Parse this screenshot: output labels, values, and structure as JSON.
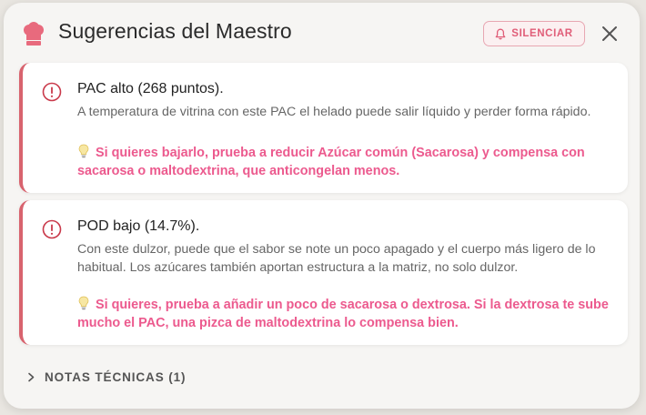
{
  "header": {
    "title": "Sugerencias del Maestro",
    "icon": "chef-hat-icon",
    "silence_label": "SILENCIAR",
    "close_icon": "close-icon"
  },
  "cards": [
    {
      "title": "PAC alto (268 puntos).",
      "body": "A temperatura de vitrina con este PAC el helado puede salir líquido y perder forma rápido.",
      "tip": "Si quieres bajarlo, prueba a reducir Azúcar común (Sacarosa) y compensa con sacarosa o maltodextrina, que anticongelan menos."
    },
    {
      "title": "POD bajo (14.7%).",
      "body": "Con este dulzor, puede que el sabor se note un poco apagado y el cuerpo más ligero de lo habitual. Los azúcares también aportan estructura a la matriz, no solo dulzor.",
      "tip": "Si quieres, prueba a añadir un poco de sacarosa o dextrosa. Si la dextrosa te sube mucho el PAC, una pizca de maltodextrina lo compensa bien."
    }
  ],
  "notes": {
    "label": "NOTAS TÉCNICAS (1)"
  },
  "colors": {
    "accent": "#ec5a8e",
    "card_border": "#d8636e",
    "alert": "#c9394a",
    "silence_border": "#e8a7b2"
  }
}
